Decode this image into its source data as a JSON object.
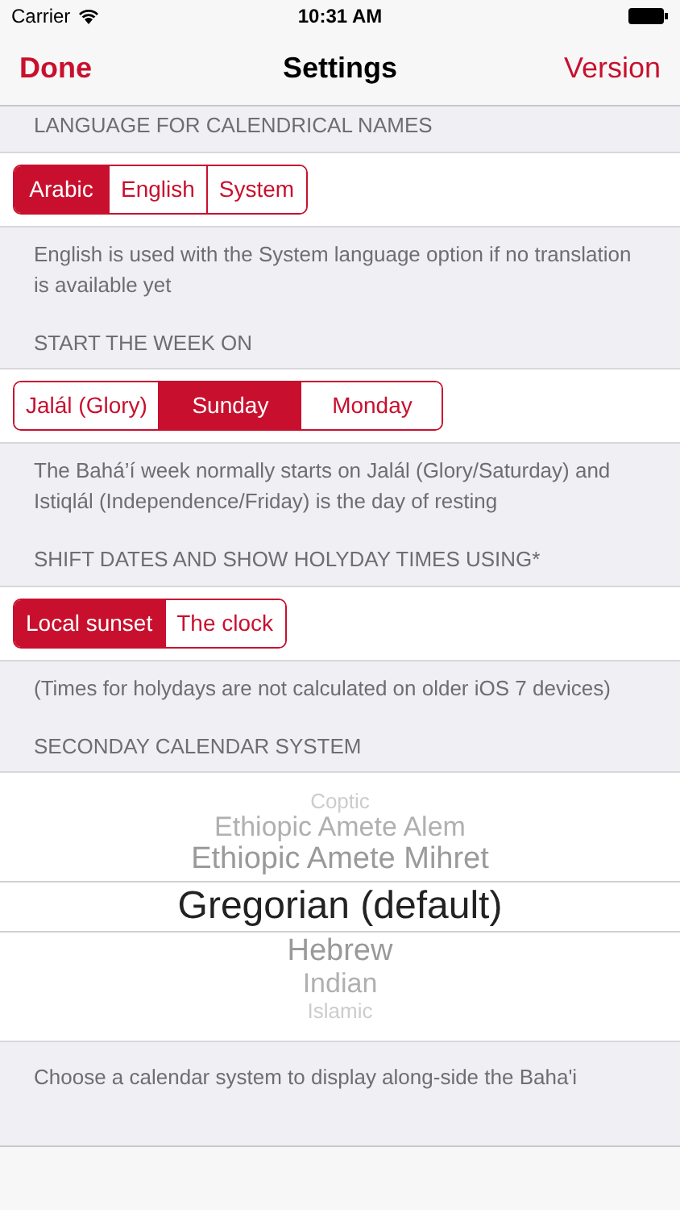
{
  "status_bar": {
    "carrier": "Carrier",
    "time": "10:31 AM"
  },
  "nav": {
    "left": "Done",
    "title": "Settings",
    "right": "Version"
  },
  "sections": [
    {
      "header": "LANGUAGE FOR CALENDRICAL NAMES",
      "kind": "segments",
      "segments": [
        {
          "label": "Arabic",
          "selected": true
        },
        {
          "label": "English",
          "selected": false
        },
        {
          "label": "System",
          "selected": false
        }
      ],
      "footer": "English is used with the System language option if no translation is available yet"
    },
    {
      "header": "START THE WEEK ON",
      "kind": "segments",
      "segments": [
        {
          "label": "Jalál (Glory)",
          "selected": false
        },
        {
          "label": "Sunday",
          "selected": true
        },
        {
          "label": "Monday",
          "selected": false
        }
      ],
      "footer": "The Bahá’í week normally starts on Jalál (Glory/Saturday) and Istiqlál (Independence/Friday) is the day of resting"
    },
    {
      "header": "SHIFT DATES AND SHOW HOLYDAY TIMES USING*",
      "kind": "segments",
      "segments": [
        {
          "label": "Local sunset",
          "selected": true
        },
        {
          "label": "The clock",
          "selected": false
        }
      ],
      "footer": "(Times for holydays are not calculated on older iOS 7 devices)"
    },
    {
      "header": "SECONDAY CALENDAR SYSTEM",
      "kind": "picker",
      "options": [
        {
          "label": "Coptic",
          "selected": false
        },
        {
          "label": "Ethiopic Amete Alem",
          "selected": false
        },
        {
          "label": "Ethiopic Amete Mihret",
          "selected": false
        },
        {
          "label": "Gregorian (default)",
          "selected": true
        },
        {
          "label": "Hebrew",
          "selected": false
        },
        {
          "label": "Indian",
          "selected": false
        },
        {
          "label": "Islamic",
          "selected": false
        }
      ],
      "footer": "Choose a calendar system to display along-side the Baha'i"
    }
  ]
}
